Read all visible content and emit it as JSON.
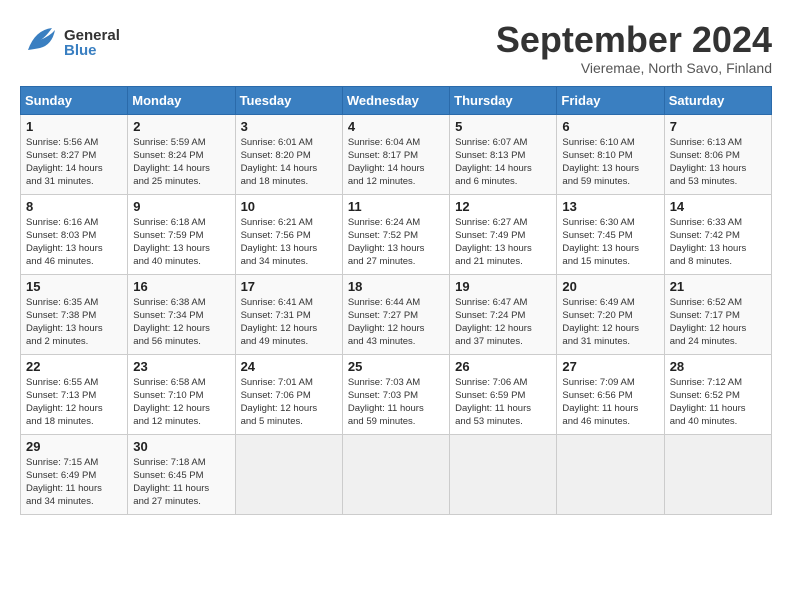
{
  "header": {
    "logo_general": "General",
    "logo_blue": "Blue",
    "month_title": "September 2024",
    "subtitle": "Vieremae, North Savo, Finland"
  },
  "calendar": {
    "days_of_week": [
      "Sunday",
      "Monday",
      "Tuesday",
      "Wednesday",
      "Thursday",
      "Friday",
      "Saturday"
    ],
    "weeks": [
      [
        {
          "day": "",
          "detail": ""
        },
        {
          "day": "2",
          "detail": "Sunrise: 5:59 AM\nSunset: 8:24 PM\nDaylight: 14 hours\nand 25 minutes."
        },
        {
          "day": "3",
          "detail": "Sunrise: 6:01 AM\nSunset: 8:20 PM\nDaylight: 14 hours\nand 18 minutes."
        },
        {
          "day": "4",
          "detail": "Sunrise: 6:04 AM\nSunset: 8:17 PM\nDaylight: 14 hours\nand 12 minutes."
        },
        {
          "day": "5",
          "detail": "Sunrise: 6:07 AM\nSunset: 8:13 PM\nDaylight: 14 hours\nand 6 minutes."
        },
        {
          "day": "6",
          "detail": "Sunrise: 6:10 AM\nSunset: 8:10 PM\nDaylight: 13 hours\nand 59 minutes."
        },
        {
          "day": "7",
          "detail": "Sunrise: 6:13 AM\nSunset: 8:06 PM\nDaylight: 13 hours\nand 53 minutes."
        }
      ],
      [
        {
          "day": "1",
          "detail": "Sunrise: 5:56 AM\nSunset: 8:27 PM\nDaylight: 14 hours\nand 31 minutes."
        },
        {
          "day": "",
          "detail": ""
        },
        {
          "day": "",
          "detail": ""
        },
        {
          "day": "",
          "detail": ""
        },
        {
          "day": "",
          "detail": ""
        },
        {
          "day": "",
          "detail": ""
        },
        {
          "day": "",
          "detail": ""
        }
      ],
      [
        {
          "day": "8",
          "detail": "Sunrise: 6:16 AM\nSunset: 8:03 PM\nDaylight: 13 hours\nand 46 minutes."
        },
        {
          "day": "9",
          "detail": "Sunrise: 6:18 AM\nSunset: 7:59 PM\nDaylight: 13 hours\nand 40 minutes."
        },
        {
          "day": "10",
          "detail": "Sunrise: 6:21 AM\nSunset: 7:56 PM\nDaylight: 13 hours\nand 34 minutes."
        },
        {
          "day": "11",
          "detail": "Sunrise: 6:24 AM\nSunset: 7:52 PM\nDaylight: 13 hours\nand 27 minutes."
        },
        {
          "day": "12",
          "detail": "Sunrise: 6:27 AM\nSunset: 7:49 PM\nDaylight: 13 hours\nand 21 minutes."
        },
        {
          "day": "13",
          "detail": "Sunrise: 6:30 AM\nSunset: 7:45 PM\nDaylight: 13 hours\nand 15 minutes."
        },
        {
          "day": "14",
          "detail": "Sunrise: 6:33 AM\nSunset: 7:42 PM\nDaylight: 13 hours\nand 8 minutes."
        }
      ],
      [
        {
          "day": "15",
          "detail": "Sunrise: 6:35 AM\nSunset: 7:38 PM\nDaylight: 13 hours\nand 2 minutes."
        },
        {
          "day": "16",
          "detail": "Sunrise: 6:38 AM\nSunset: 7:34 PM\nDaylight: 12 hours\nand 56 minutes."
        },
        {
          "day": "17",
          "detail": "Sunrise: 6:41 AM\nSunset: 7:31 PM\nDaylight: 12 hours\nand 49 minutes."
        },
        {
          "day": "18",
          "detail": "Sunrise: 6:44 AM\nSunset: 7:27 PM\nDaylight: 12 hours\nand 43 minutes."
        },
        {
          "day": "19",
          "detail": "Sunrise: 6:47 AM\nSunset: 7:24 PM\nDaylight: 12 hours\nand 37 minutes."
        },
        {
          "day": "20",
          "detail": "Sunrise: 6:49 AM\nSunset: 7:20 PM\nDaylight: 12 hours\nand 31 minutes."
        },
        {
          "day": "21",
          "detail": "Sunrise: 6:52 AM\nSunset: 7:17 PM\nDaylight: 12 hours\nand 24 minutes."
        }
      ],
      [
        {
          "day": "22",
          "detail": "Sunrise: 6:55 AM\nSunset: 7:13 PM\nDaylight: 12 hours\nand 18 minutes."
        },
        {
          "day": "23",
          "detail": "Sunrise: 6:58 AM\nSunset: 7:10 PM\nDaylight: 12 hours\nand 12 minutes."
        },
        {
          "day": "24",
          "detail": "Sunrise: 7:01 AM\nSunset: 7:06 PM\nDaylight: 12 hours\nand 5 minutes."
        },
        {
          "day": "25",
          "detail": "Sunrise: 7:03 AM\nSunset: 7:03 PM\nDaylight: 11 hours\nand 59 minutes."
        },
        {
          "day": "26",
          "detail": "Sunrise: 7:06 AM\nSunset: 6:59 PM\nDaylight: 11 hours\nand 53 minutes."
        },
        {
          "day": "27",
          "detail": "Sunrise: 7:09 AM\nSunset: 6:56 PM\nDaylight: 11 hours\nand 46 minutes."
        },
        {
          "day": "28",
          "detail": "Sunrise: 7:12 AM\nSunset: 6:52 PM\nDaylight: 11 hours\nand 40 minutes."
        }
      ],
      [
        {
          "day": "29",
          "detail": "Sunrise: 7:15 AM\nSunset: 6:49 PM\nDaylight: 11 hours\nand 34 minutes."
        },
        {
          "day": "30",
          "detail": "Sunrise: 7:18 AM\nSunset: 6:45 PM\nDaylight: 11 hours\nand 27 minutes."
        },
        {
          "day": "",
          "detail": ""
        },
        {
          "day": "",
          "detail": ""
        },
        {
          "day": "",
          "detail": ""
        },
        {
          "day": "",
          "detail": ""
        },
        {
          "day": "",
          "detail": ""
        }
      ]
    ]
  }
}
